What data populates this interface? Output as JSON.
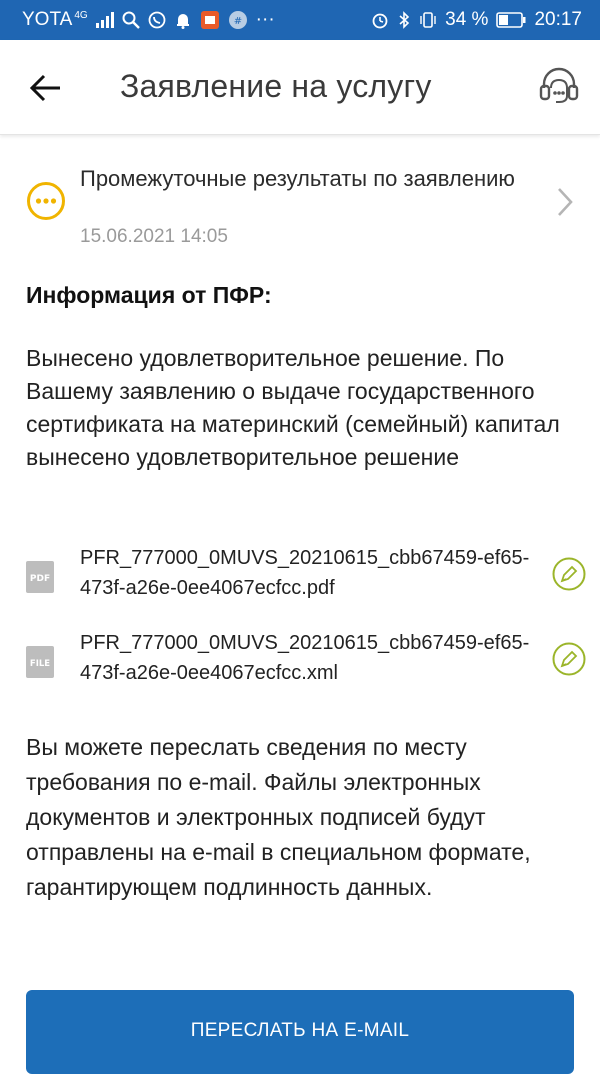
{
  "status_bar": {
    "carrier": "YOTA",
    "network": "4G",
    "battery_percent": "34 %",
    "time": "20:17"
  },
  "header": {
    "title": "Заявление на услугу"
  },
  "status": {
    "text": "Промежуточные результаты по заявлению",
    "date": "15.06.2021 14:05"
  },
  "info": {
    "heading": "Информация от ПФР:",
    "body": "Вынесено удовлетворительное решение. По Вашему заявлению о выдаче государственного сертификата на материнский (семейный) капитал вынесено удовлетворительное решение"
  },
  "files": [
    {
      "type_label": "PDF",
      "name": "PFR_777000_0MUVS_20210615_cbb67459-ef65-473f-a26e-0ee4067ecfcc.pdf"
    },
    {
      "type_label": "FILE",
      "name": "PFR_777000_0MUVS_20210615_cbb67459-ef65-473f-a26e-0ee4067ecfcc.xml"
    }
  ],
  "footer_text": "Вы можете переслать сведения по месту требования по e-mail. Файлы электронных документов и электронных подписей будут отправлены на e-mail в специальном формате, гарантирующем подлинность данных.",
  "send_button_label": "ПЕРЕСЛАТЬ НА E-MAIL",
  "colors": {
    "status_bar": "#1f66b3",
    "primary_button": "#1d6eb8",
    "pending_icon": "#f0b400",
    "sign_icon": "#9bb52a"
  }
}
